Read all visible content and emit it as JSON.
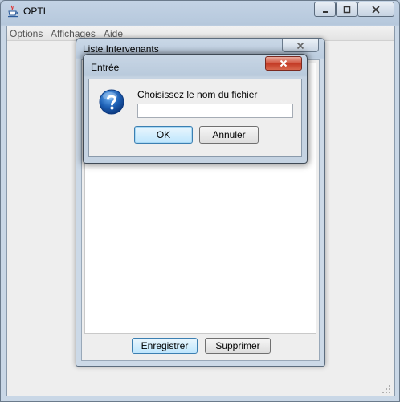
{
  "main_window": {
    "title": "OPTI",
    "menu": [
      "Options",
      "Affichages",
      "Aide"
    ]
  },
  "list_window": {
    "title": "Liste Intervenants",
    "buttons": {
      "save": "Enregistrer",
      "delete": "Supprimer"
    }
  },
  "dialog": {
    "title": "Entrée",
    "message": "Choisissez le nom du fichier",
    "input_value": "",
    "buttons": {
      "ok": "OK",
      "cancel": "Annuler"
    }
  },
  "icons": {
    "app": "java-cup-icon",
    "dialog": "question-icon"
  },
  "colors": {
    "close_button": "#c33a25",
    "question_icon": "#1c5fb4",
    "focused_button": "#bee6fd"
  }
}
